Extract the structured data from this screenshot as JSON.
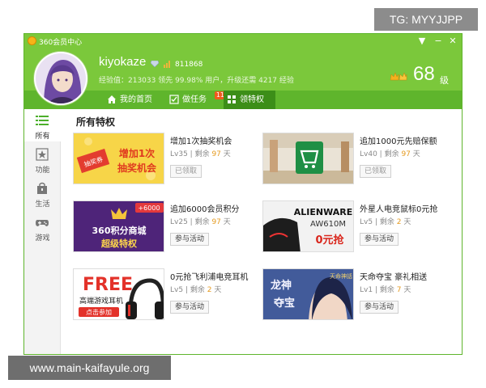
{
  "corner_tag": "TG: MYYJJPP",
  "window": {
    "title": "360会员中心",
    "controls": {
      "menu": "▼",
      "minimize": "−",
      "close": "✕"
    }
  },
  "profile": {
    "username": "kiyokaze",
    "user_id": "811868",
    "exp_line": "经验值：213033  领先 99.98% 用户，升级还需 4217 经验",
    "level": "68",
    "level_unit": "级"
  },
  "tabs": [
    {
      "label": "我的首页",
      "icon": "home-icon"
    },
    {
      "label": "做任务",
      "icon": "checklist-icon",
      "badge": "11"
    },
    {
      "label": "领特权",
      "icon": "grid-icon",
      "active": true
    }
  ],
  "sidebar": [
    {
      "label": "所有",
      "icon": "list-icon",
      "active": true
    },
    {
      "label": "功能",
      "icon": "star-icon"
    },
    {
      "label": "生活",
      "icon": "bag-icon"
    },
    {
      "label": "游戏",
      "icon": "gamepad-icon"
    }
  ],
  "section_title": "所有特权",
  "cards": [
    {
      "title": "增加1次抽奖机会",
      "level": "Lv35",
      "remain_label": "剩余",
      "remain": "97",
      "unit": "天",
      "button": "已领取",
      "claimed": true,
      "banner": {
        "text1": "增加1次",
        "text2": "抽奖机会",
        "tag": "抽奖券"
      }
    },
    {
      "title": "追加1000元先赔保额",
      "level": "Lv40",
      "remain_label": "剩余",
      "remain": "97",
      "unit": "天",
      "button": "已领取",
      "claimed": true,
      "banner": {}
    },
    {
      "title": "追加6000会员积分",
      "level": "Lv25",
      "remain_label": "剩余",
      "remain": "97",
      "unit": "天",
      "button": "参与活动",
      "claimed": false,
      "banner": {
        "corner": "+6000",
        "text1": "360积分商城",
        "text2": "超级特权"
      }
    },
    {
      "title": "外星人电竞鼠标0元抢",
      "level": "Lv5",
      "remain_label": "剩余",
      "remain": "2",
      "unit": "天",
      "button": "参与活动",
      "claimed": false,
      "banner": {
        "text1": "ALIENWARE",
        "text2": "AW610M",
        "text3": "0元抢"
      }
    },
    {
      "title": "0元抢飞利浦电竞耳机",
      "level": "Lv5",
      "remain_label": "剩余",
      "remain": "2",
      "unit": "天",
      "button": "参与活动",
      "claimed": false,
      "banner": {
        "text1": "FREE",
        "text2": "高端游戏耳机",
        "text3": "点击参加"
      }
    },
    {
      "title": "天命夺宝 豪礼相送",
      "level": "Lv1",
      "remain_label": "剩余",
      "remain": "7",
      "unit": "天",
      "button": "参与活动",
      "claimed": false,
      "banner": {
        "text1": "龙神",
        "text2": "夺宝",
        "text3": "天命神話"
      }
    }
  ],
  "watermark": "www.main-kaifayule.org",
  "colors": {
    "brand_green": "#7bc83b",
    "tab_green": "#5fb52c",
    "active_tab": "#3c8e18",
    "badge": "#f05a1d",
    "remain_num": "#e59a1f"
  }
}
